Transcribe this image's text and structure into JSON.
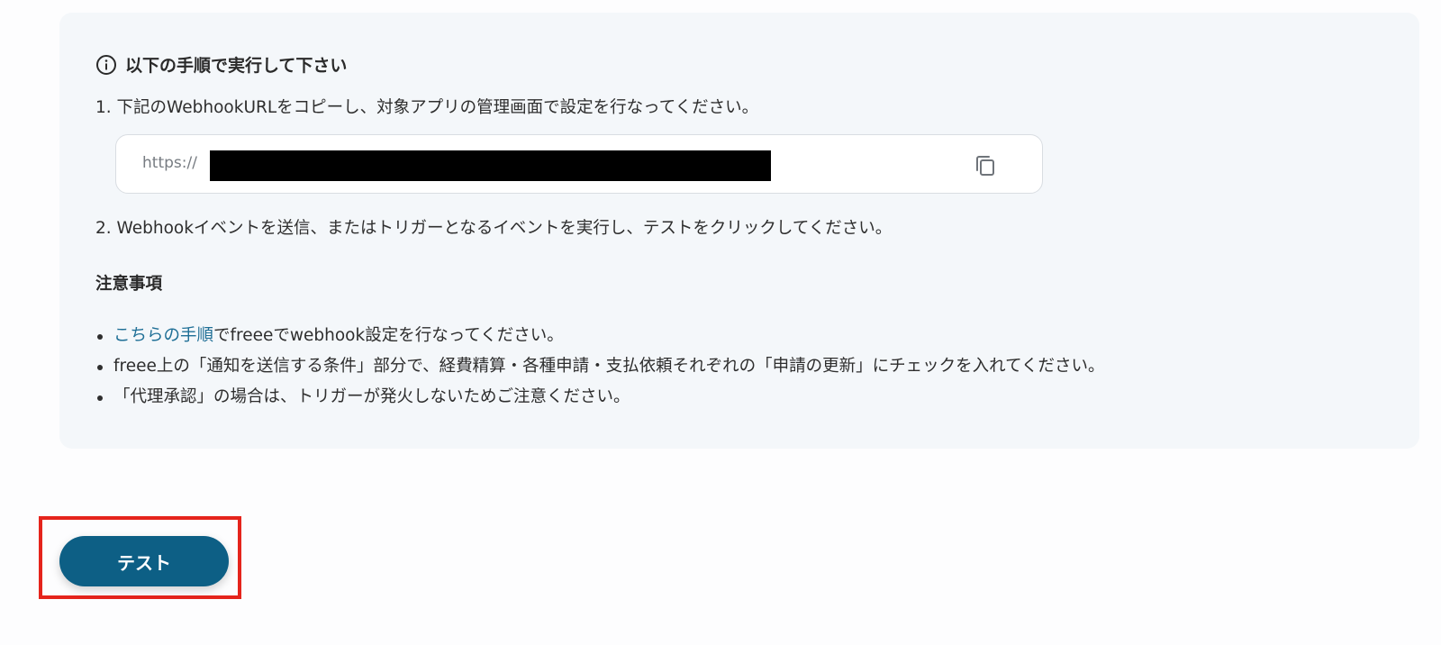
{
  "instructions": {
    "title": "以下の手順で実行して下さい",
    "info_icon": "info-circle-icon",
    "step1": "1. 下記のWebhookURLをコピーし、対象アプリの管理画面で設定を行なってください。",
    "step2": "2. Webhookイベントを送信、またはトリガーとなるイベントを実行し、テストをクリックしてください。"
  },
  "webhook_url": {
    "prefix": "https://",
    "redacted": true,
    "copy_icon": "copy-icon"
  },
  "notes": {
    "title": "注意事項",
    "item1_link": "こちらの手順",
    "item1_rest": "でfreeeでwebhook設定を行なってください。",
    "item2": "freee上の「通知を送信する条件」部分で、経費精算・各種申請・支払依頼それぞれの「申請の更新」にチェックを入れてください。",
    "item3": "「代理承認」の場合は、トリガーが発火しないためご注意ください。"
  },
  "actions": {
    "test_label": "テスト"
  },
  "colors": {
    "panel_bg": "#f4f7fa",
    "link": "#1f6f96",
    "button_bg": "#0d5f85",
    "highlight_border": "#e5241c"
  }
}
